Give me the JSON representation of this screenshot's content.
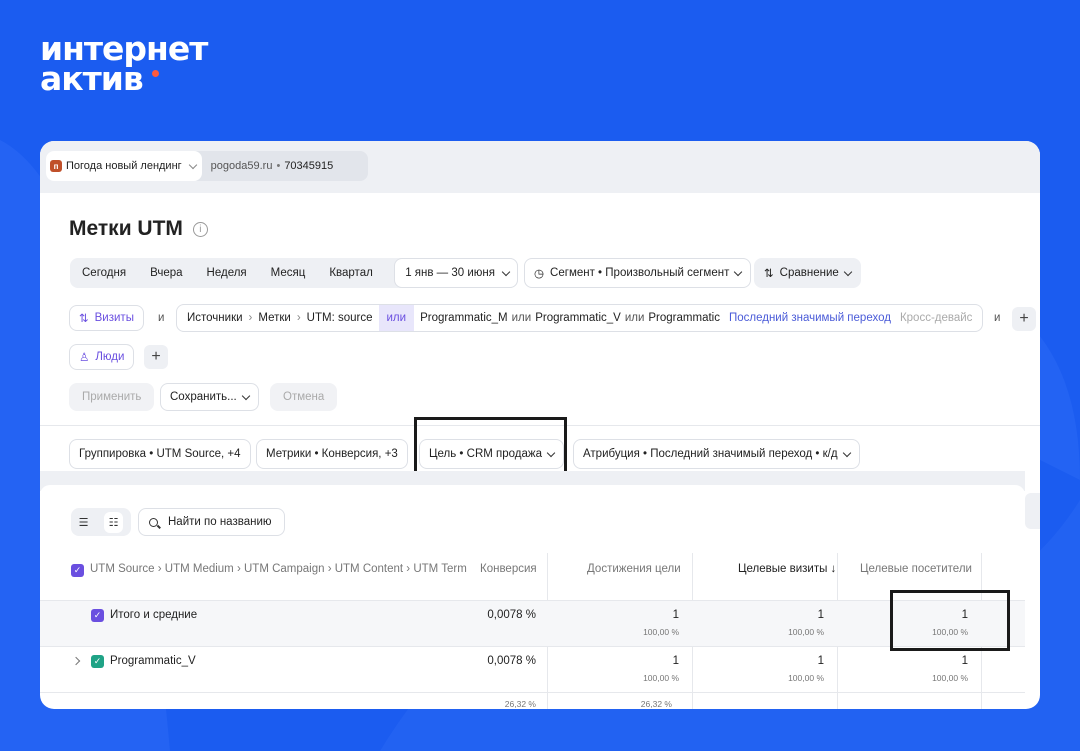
{
  "brand": {
    "line1": "интернет",
    "line2": "актив"
  },
  "site": {
    "badge": "п",
    "name": "Погода новый лендинг",
    "domain": "pogoda59.ru",
    "separator": "•",
    "counter_id": "70345915"
  },
  "page": {
    "title": "Метки UTM",
    "info_icon": "i"
  },
  "period": {
    "options": [
      "Сегодня",
      "Вчера",
      "Неделя",
      "Месяц",
      "Квартал"
    ],
    "range": "1 янв — 30 июня"
  },
  "segment_label": "Сегмент • Произвольный сегмент",
  "compare_label": "Сравнение",
  "filters": {
    "visits_label": "Визиты",
    "and_word": "и",
    "path": [
      "Источники",
      "Метки",
      "UTM: source"
    ],
    "or_label": "или",
    "values": [
      "Programmatic_M",
      "Programmatic_V",
      "Programmatic"
    ],
    "or_word": "или",
    "attribution": "Последний значимый переход",
    "cross_device": "Кросс-девайс",
    "close_icon": "×",
    "people_label": "Люди",
    "plus": "+"
  },
  "actions": {
    "apply": "Применить",
    "save": "Сохранить...",
    "cancel": "Отмена"
  },
  "report_settings": {
    "grouping": "Группировка • UTM Source, +4",
    "metrics": "Метрики • Конверсия, +3",
    "goal": "Цель • CRM продажа",
    "attribution": "Атрибуция • Последний значимый переход • к/д"
  },
  "search": {
    "label": "Найти по названию"
  },
  "table": {
    "headers": {
      "dimensions": "UTM Source › UTM Medium › UTM Campaign › UTM Content › UTM Term",
      "conversion": "Конверсия",
      "achievements": "Достижения цели",
      "target_visits": "Целевые визиты ↓",
      "target_visitors": "Целевые посетители"
    },
    "rows": [
      {
        "name": "Итого и средние",
        "conversion": "0,0078 %",
        "achievements": "1",
        "achievements_pct": "100,00 %",
        "visits": "1",
        "visits_pct": "100,00 %",
        "visitors": "1",
        "visitors_pct": "100,00 %"
      },
      {
        "name": "Programmatic_V",
        "conversion": "0,0078 %",
        "achievements": "1",
        "achievements_pct": "100,00 %",
        "visits": "1",
        "visits_pct": "100,00 %",
        "visitors": "1",
        "visitors_pct": "100,00 %"
      }
    ],
    "partial_row": {
      "conversion": "26,32 %",
      "achievements": "26,32 %"
    }
  },
  "colors": {
    "background": "#1b5cf0",
    "accent": "#6a4fe0",
    "logo_dot": "#ff5a3c",
    "check_green": "#1fa386"
  }
}
